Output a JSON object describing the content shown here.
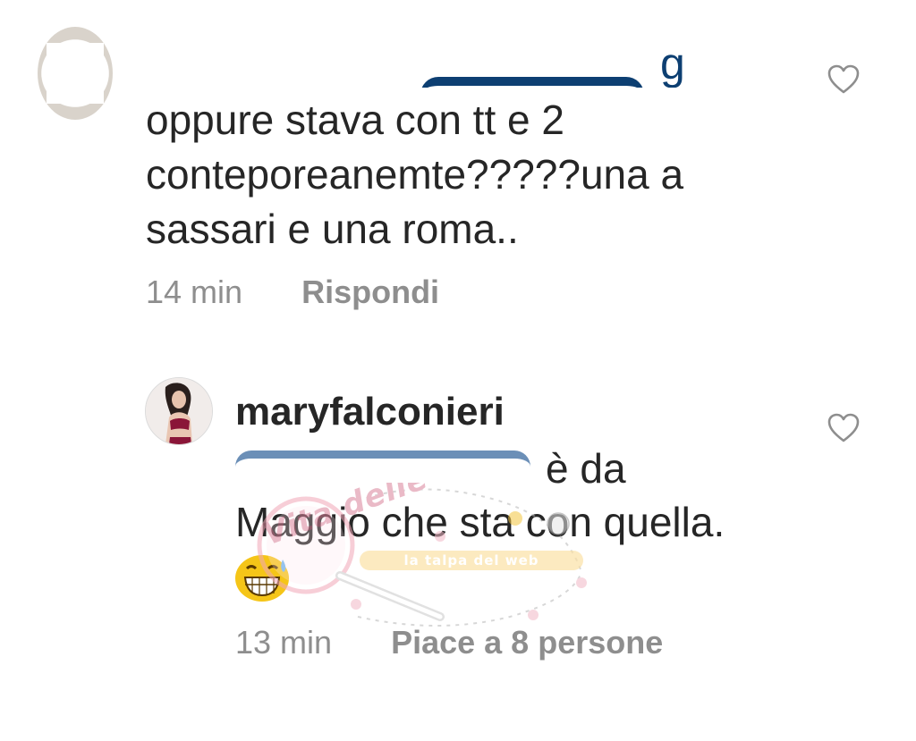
{
  "comments": [
    {
      "text": "oppure stava con tt e 2 conteporeanemte?????una a sassari e una roma..",
      "mention_tail": "g",
      "time": "14 min",
      "reply_label": "Rispondi",
      "like_icon": "heart-outline-icon"
    },
    {
      "username": "maryfalconieri",
      "text_line1": "è da",
      "text_line2": "Maggio che sta con quella.",
      "emoji_icon": "grinning-face-with-sweat-icon",
      "time": "13 min",
      "likes_label": "Piace a 8 persone",
      "like_icon": "heart-outline-icon"
    }
  ],
  "watermark": {
    "script_text": "Vita delle Vip",
    "banner_text": "la talpa del web"
  },
  "colors": {
    "text": "#262626",
    "meta": "#8e8e8e",
    "mention": "#003569",
    "background": "#ffffff"
  }
}
